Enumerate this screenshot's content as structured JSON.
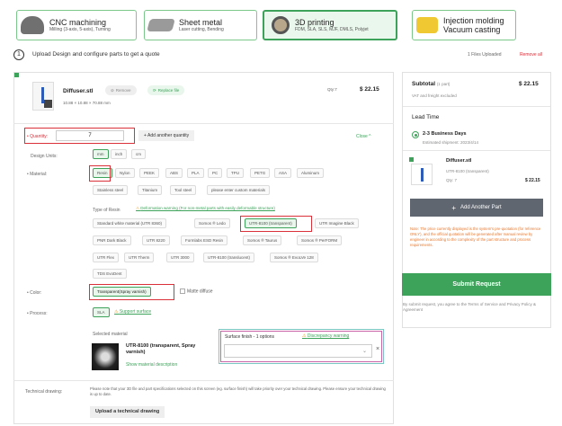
{
  "tabs": [
    {
      "title": "CNC machining",
      "sub": "Milling (3-axis, 5-axis), Turning",
      "icon": "cnc-icon"
    },
    {
      "title": "Sheet metal",
      "sub": "Laser cutting, Bending",
      "icon": "sheet-metal-icon"
    },
    {
      "title": "3D printing",
      "sub": "FDM, SLA, SLS, MJF, DMLS, Polyjet",
      "icon": "3d-printing-icon"
    },
    {
      "title": "Injection molding",
      "title2": "Vacuum casting",
      "icon": "injection-molding-icon"
    }
  ],
  "upload": {
    "step": "1",
    "text": "Upload Design and configure parts to get a quote",
    "files": "1 Files Uploaded",
    "remove_all": "Remove all"
  },
  "part": {
    "name": "Diffuser.stl",
    "remove": "Remove",
    "replace": "Replace file",
    "dims": "10.88 × 10.88 × 70.88 mm",
    "qty_label": "Qty:7",
    "price": "$ 22.15"
  },
  "config": {
    "quantity_label": "• Quantity:",
    "quantity": "7",
    "add_quantity": "+ Add another quantity",
    "close": "Close ^",
    "units_label": "Design Units:",
    "units": [
      "mm",
      "inch",
      "cm"
    ],
    "material_label": "• Material:",
    "materials": [
      "Resin",
      "Nylon",
      "PEEK",
      "ABS",
      "PLA",
      "PC",
      "TPU",
      "PETG",
      "ASA",
      "Aluminum",
      "Stainless steel",
      "Titanium",
      "Tool steel",
      "please enter custom materials"
    ],
    "resin_type_label": "Type of Resin",
    "deform_warning": "Deformation warning (For non-metal parts with easily deformable structure)",
    "resins": [
      "Standard white material (UTR 8360)",
      "Somos ® Ledo",
      "UTR-8100 (transparent)",
      "UTR Imagine Black",
      "PNR Dark Black",
      "UTR 8220",
      "Formlabs ESD Resin",
      "Somos ® Taurus",
      "Somos ® PerFORM",
      "UTR Flex",
      "UTR Therm",
      "UTR 3000",
      "UTR-8100 (translucent)",
      "Somos ® EvoLVe 128",
      "TDS EvoDent"
    ],
    "color_label": "• Color:",
    "colors": [
      "Transparent(Spray varnish)",
      "Matte diffuse"
    ],
    "process_label": "• Process:",
    "process": "SLA",
    "support": "Support surface",
    "selected_label": "Selected material",
    "selected_name": "UTR-8100 (transparent, Spray varnish)",
    "show_desc": "Show material description",
    "finish_label": "Surface finish - 1 options",
    "finish_warning": "Discrepancy warning",
    "drawing_label": "Technical drawing:",
    "drawing_note": "Please note that your 3D file and part specifications selected on this screen (eg. surface finish) will take priority over your technical drawing. Please ensure your technical drawing is up to date.",
    "upload_drawing": "Upload a technical drawing"
  },
  "summary": {
    "subtotal_label": "Subtotal",
    "subtotal_sub": "(1 part)",
    "subtotal": "$ 22.15",
    "vat_note": "VAT and freight excluded",
    "lead_label": "Lead Time",
    "lead_option": "2-3 Business Days",
    "lead_est": "Estimated shipment: 2023/4/14",
    "item_name": "Diffuser.stl",
    "item_mat": "UTR-8100 (transparent)",
    "item_qty": "Qty: 7",
    "item_price": "$ 22.15",
    "add_part": "Add Another Part",
    "note": "Note: The price currently displayed is the system's pre-quotation (for reference ONLY), and the official quotation will be generated after manual review by engineer in according to the complexity of the part structure and process requirements.",
    "submit": "Submit Request",
    "terms": "By submit request, you agree to the Terms of Service and Privacy Policy & Agreement"
  },
  "colors": {
    "accent": "#3da35a",
    "highlight": "#d9303a",
    "note_text": "#e8782e",
    "grey_button": "#5f6670"
  }
}
